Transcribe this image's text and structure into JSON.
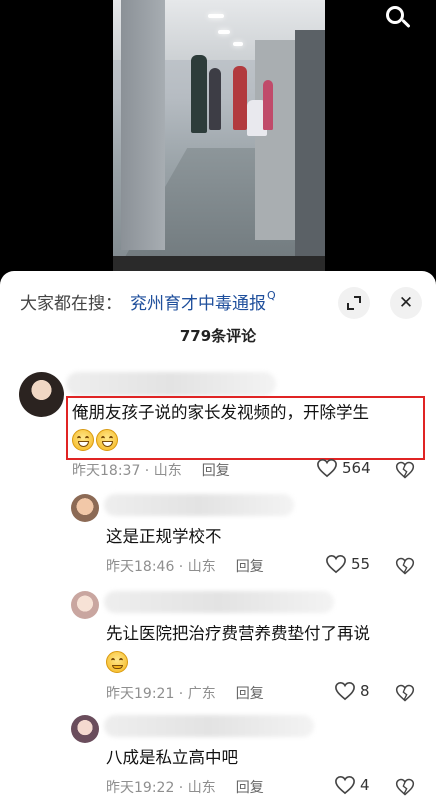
{
  "colors": {
    "accent": "#1f4f9c",
    "highlight_border": "#e02424",
    "meta": "#8f8f8f"
  },
  "video": {
    "search_icon": "search-icon"
  },
  "sheet": {
    "trending_prefix": "大家都在搜：",
    "trending_query": "兖州育才中毒通报",
    "trending_icon": "Q",
    "comment_count": "779条评论",
    "expand_icon": "expand-icon",
    "close_icon": "close-icon"
  },
  "comments": [
    {
      "text_line1": "俺朋友孩子说的家长发视频的，开除学生",
      "time": "昨天18:37 · 山东",
      "reply": "回复",
      "likes": "564"
    },
    {
      "text_line1": "这是正规学校不",
      "time": "昨天18:46 · 山东",
      "reply": "回复",
      "likes": "55"
    },
    {
      "text_line1": "先让医院把治疗费营养费垫付了再说",
      "time": "昨天19:21 · 广东",
      "reply": "回复",
      "likes": "8"
    },
    {
      "text_line1": "八成是私立高中吧",
      "time": "昨天19:22 · 山东",
      "reply": "回复",
      "likes": "4"
    }
  ]
}
